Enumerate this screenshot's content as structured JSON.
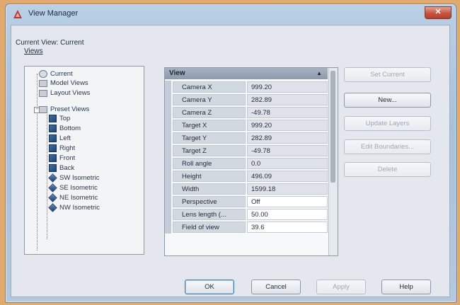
{
  "window": {
    "title": "View Manager",
    "close_symbol": "✕"
  },
  "labels": {
    "current_view": "Current View: Current",
    "views": "Views"
  },
  "tree": {
    "items": [
      {
        "label": "Current",
        "icon": "camera-icon"
      },
      {
        "label": "Model Views",
        "icon": "model-views-icon"
      },
      {
        "label": "Layout Views",
        "icon": "layout-views-icon"
      },
      {
        "label": "Preset Views",
        "icon": "preset-views-icon"
      },
      {
        "label": "Top",
        "icon": "view-cube-icon"
      },
      {
        "label": "Bottom",
        "icon": "view-cube-icon"
      },
      {
        "label": "Left",
        "icon": "view-cube-icon"
      },
      {
        "label": "Right",
        "icon": "view-cube-icon"
      },
      {
        "label": "Front",
        "icon": "view-cube-icon"
      },
      {
        "label": "Back",
        "icon": "view-cube-icon"
      },
      {
        "label": "SW Isometric",
        "icon": "isometric-icon"
      },
      {
        "label": "SE Isometric",
        "icon": "isometric-icon"
      },
      {
        "label": "NE Isometric",
        "icon": "isometric-icon"
      },
      {
        "label": "NW Isometric",
        "icon": "isometric-icon"
      }
    ]
  },
  "properties": {
    "header": "View",
    "collapse_symbol": "▲",
    "rows": [
      {
        "name": "Camera X",
        "value": "999.20"
      },
      {
        "name": "Camera Y",
        "value": "282.89"
      },
      {
        "name": "Camera Z",
        "value": "-49.78"
      },
      {
        "name": "Target X",
        "value": "999.20"
      },
      {
        "name": "Target Y",
        "value": "282.89"
      },
      {
        "name": "Target Z",
        "value": "-49.78"
      },
      {
        "name": "Roll angle",
        "value": "0.0"
      },
      {
        "name": "Height",
        "value": "496.09"
      },
      {
        "name": "Width",
        "value": "1599.18"
      },
      {
        "name": "Perspective",
        "value": "Off"
      },
      {
        "name": "Lens length (...",
        "value": "50.00"
      },
      {
        "name": "Field of view",
        "value": "39.6"
      }
    ]
  },
  "buttons": {
    "set_current": "Set Current",
    "new": "New...",
    "update_layers": "Update Layers",
    "edit_boundaries": "Edit Boundaries...",
    "delete": "Delete",
    "ok": "OK",
    "cancel": "Cancel",
    "apply": "Apply",
    "help": "Help"
  }
}
